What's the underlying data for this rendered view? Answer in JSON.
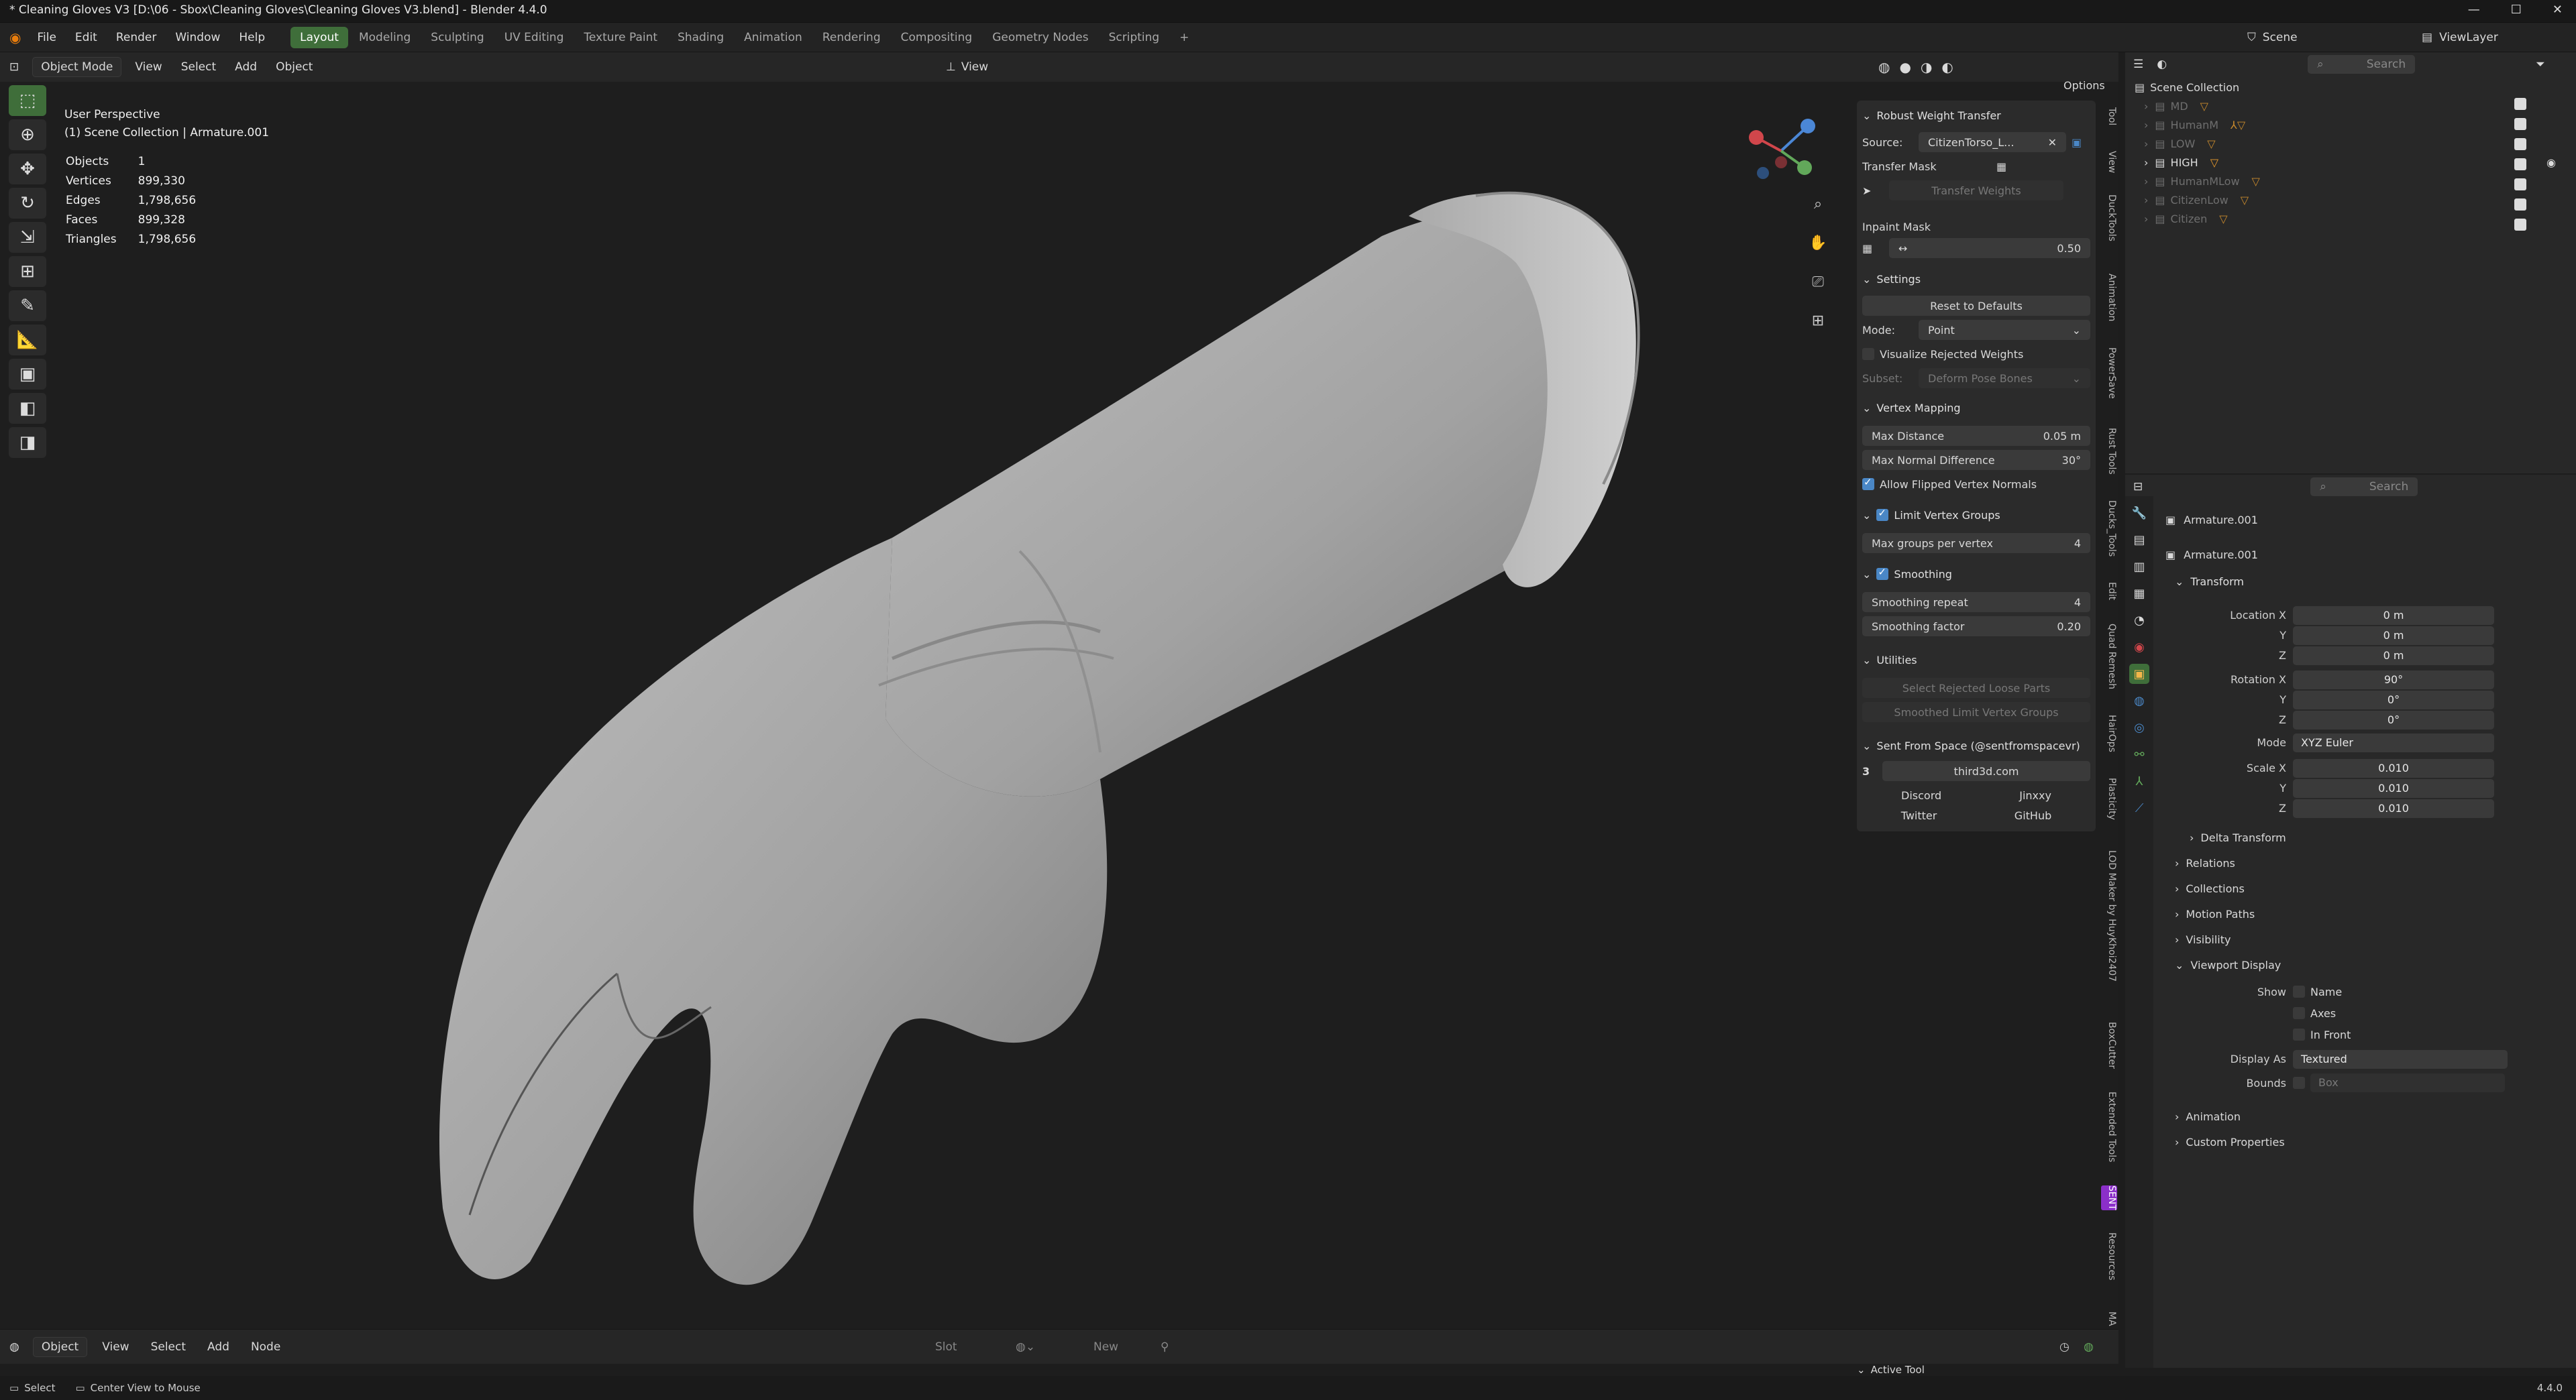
{
  "window": {
    "title": "* Cleaning Gloves V3 [D:\\06 - Sbox\\Cleaning Gloves\\Cleaning Gloves V3.blend] - Blender 4.4.0"
  },
  "menu": {
    "items": [
      "File",
      "Edit",
      "Render",
      "Window",
      "Help"
    ],
    "workspaces": [
      "Layout",
      "Modeling",
      "Sculpting",
      "UV Editing",
      "Texture Paint",
      "Shading",
      "Animation",
      "Rendering",
      "Compositing",
      "Geometry Nodes",
      "Scripting"
    ],
    "active_workspace": "Layout",
    "scene_label": "Scene",
    "viewlayer_label": "ViewLayer"
  },
  "viewport_header": {
    "mode": "Object Mode",
    "menus": [
      "View",
      "Select",
      "Add",
      "Object"
    ],
    "transform_orientation": "View",
    "options_label": "Options"
  },
  "viewport_overlay": {
    "view_name": "User Perspective",
    "collection_line": "(1) Scene Collection | Armature.001",
    "stats": [
      {
        "label": "Objects",
        "value": "1"
      },
      {
        "label": "Vertices",
        "value": "899,330"
      },
      {
        "label": "Edges",
        "value": "1,798,656"
      },
      {
        "label": "Faces",
        "value": "899,328"
      },
      {
        "label": "Triangles",
        "value": "1,798,656"
      }
    ]
  },
  "npanel": {
    "title": "Robust Weight Transfer",
    "source_label": "Source:",
    "source_value": "CitizenTorso_L...",
    "transfer_mask_label": "Transfer Mask",
    "transfer_weights_label": "Transfer Weights",
    "inpaint_mask_label": "Inpaint Mask",
    "inpaint_value": "0.50",
    "settings_label": "Settings",
    "reset_label": "Reset to Defaults",
    "mode_label": "Mode:",
    "mode_value": "Point",
    "visualize_label": "Visualize Rejected Weights",
    "subset_label": "Subset:",
    "subset_value": "Deform Pose Bones",
    "vertex_mapping_label": "Vertex Mapping",
    "max_distance_label": "Max Distance",
    "max_distance_value": "0.05 m",
    "max_normal_label": "Max Normal Difference",
    "max_normal_value": "30°",
    "allow_flipped_label": "Allow Flipped Vertex Normals",
    "limit_groups_label": "Limit Vertex Groups",
    "max_groups_label": "Max groups per vertex",
    "max_groups_value": "4",
    "smoothing_label": "Smoothing",
    "smoothing_repeat_label": "Smoothing repeat",
    "smoothing_repeat_value": "4",
    "smoothing_factor_label": "Smoothing factor",
    "smoothing_factor_value": "0.20",
    "utilities_label": "Utilities",
    "select_rejected_label": "Select Rejected Loose Parts",
    "smoothed_limit_label": "Smoothed Limit Vertex Groups",
    "sent_from_space_label": "Sent From Space (@sentfromspacevr)",
    "site_label": "third3d.com",
    "links": [
      "Discord",
      "Jinxxy",
      "Twitter",
      "GitHub"
    ]
  },
  "side_tabs": [
    "Tool",
    "View",
    "DuckTools",
    "Animation",
    "PowerSave",
    "Rust Tools",
    "Ducks_Tools",
    "Edit",
    "Quad Remesh",
    "HairOps",
    "Plasticity",
    "LOD Maker by HuyKhoi2407",
    "BoxCutter",
    "Extended Tools",
    "SENT",
    "Resources",
    "MA"
  ],
  "outliner": {
    "search_placeholder": "Search",
    "root": "Scene Collection",
    "items": [
      {
        "name": "MD",
        "dim": true
      },
      {
        "name": "HumanM",
        "dim": true
      },
      {
        "name": "LOW",
        "dim": true
      },
      {
        "name": "HIGH",
        "dim": false
      },
      {
        "name": "HumanMLow",
        "dim": true
      },
      {
        "name": "CitizenLow",
        "dim": true
      },
      {
        "name": "Citizen",
        "dim": true
      }
    ]
  },
  "properties": {
    "search_placeholder": "Search",
    "object_name": "Armature.001",
    "data_name": "Armature.001",
    "transform_label": "Transform",
    "location_x_label": "Location X",
    "y_label": "Y",
    "z_label": "Z",
    "location": [
      "0 m",
      "0 m",
      "0 m"
    ],
    "rotation_x_label": "Rotation X",
    "rotation": [
      "90°",
      "0°",
      "0°"
    ],
    "mode_label": "Mode",
    "mode_value": "XYZ Euler",
    "scale_x_label": "Scale X",
    "scale": [
      "0.010",
      "0.010",
      "0.010"
    ],
    "delta_transform_label": "Delta Transform",
    "sections": [
      "Relations",
      "Collections",
      "Motion Paths",
      "Visibility"
    ],
    "viewport_display_label": "Viewport Display",
    "show_label": "Show",
    "show_items": [
      "Name",
      "Axes",
      "In Front"
    ],
    "display_as_label": "Display As",
    "display_as_value": "Textured",
    "bounds_label": "Bounds",
    "bounds_value": "Box",
    "tail_sections": [
      "Animation",
      "Custom Properties"
    ]
  },
  "node_header": {
    "editor": "Object",
    "menus": [
      "View",
      "Select",
      "Add",
      "Node"
    ],
    "slot_label": "Slot",
    "new_label": "New",
    "active_tool_label": "Active Tool"
  },
  "statusbar": {
    "select_label": "Select",
    "center_label": "Center View to Mouse",
    "version": "4.4.0"
  },
  "colors": {
    "accent_green": "#3f6e3a",
    "checkbox_blue": "#4a87c6",
    "glove_gray": "#a8a8a8"
  }
}
